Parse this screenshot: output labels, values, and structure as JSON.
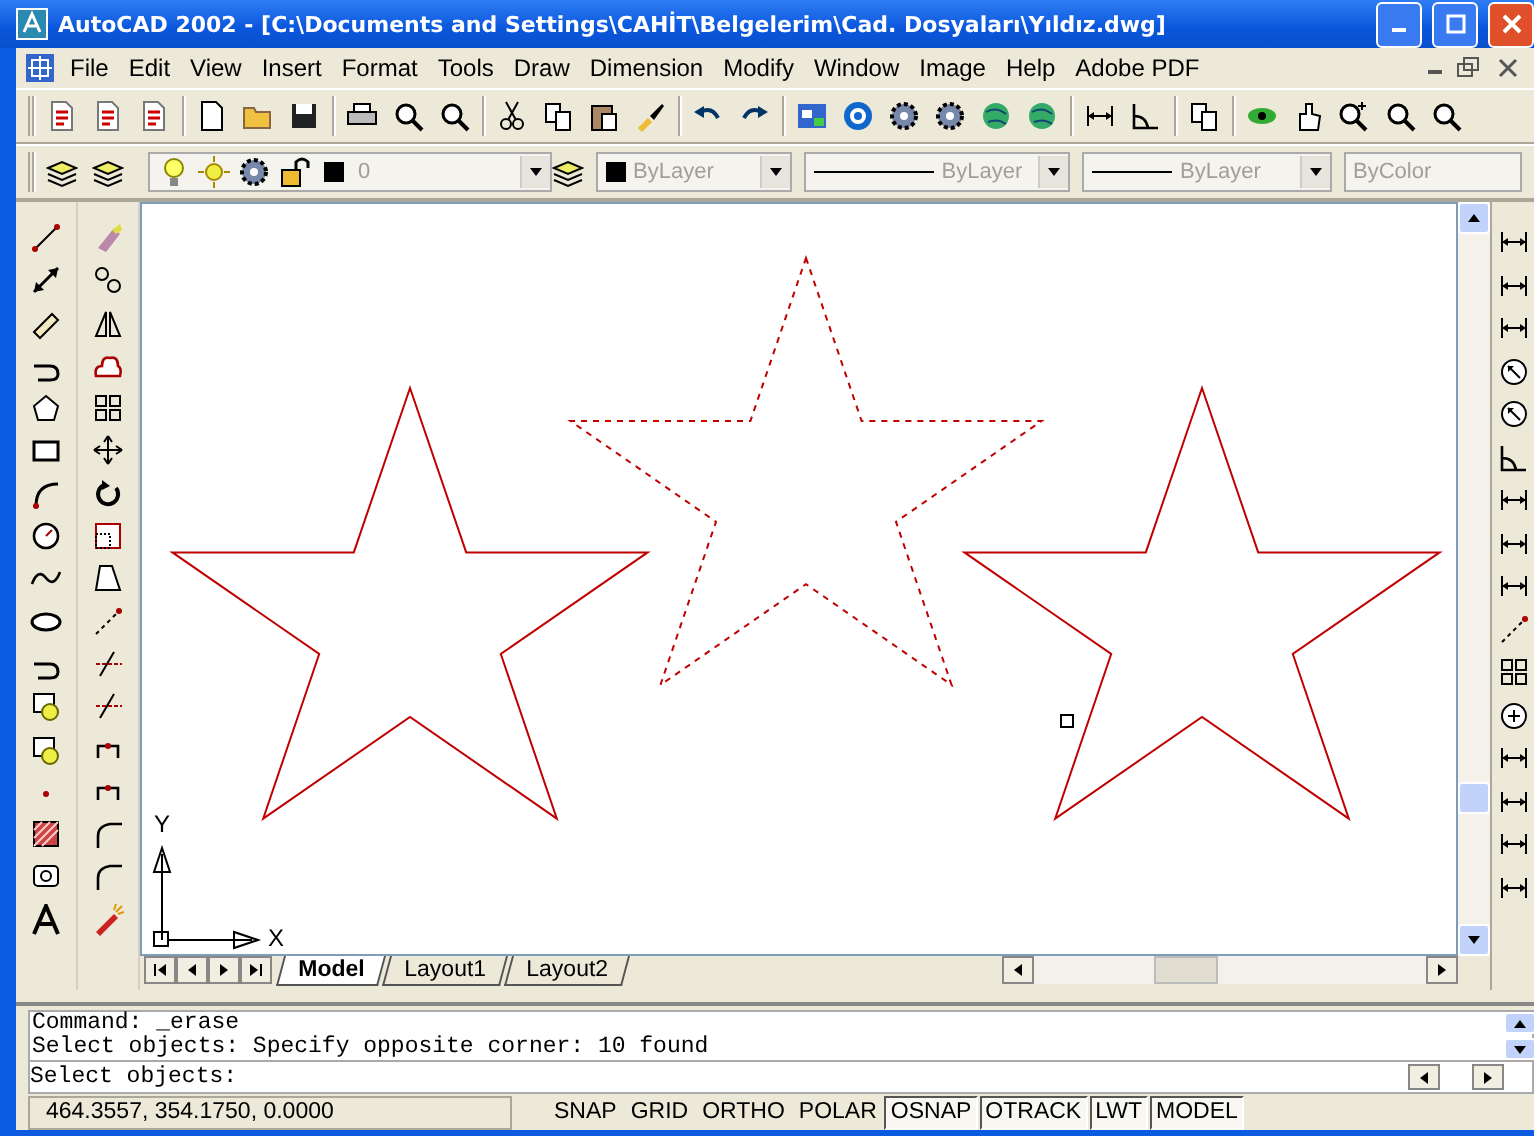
{
  "window": {
    "title": "AutoCAD 2002 - [C:\\Documents and Settings\\CAHİT\\Belgelerim\\Cad. Dosyaları\\Yıldız.dwg]"
  },
  "menu": [
    "File",
    "Edit",
    "View",
    "Insert",
    "Format",
    "Tools",
    "Draw",
    "Dimension",
    "Modify",
    "Window",
    "Image",
    "Help",
    "Adobe PDF"
  ],
  "properties_bar": {
    "layer": {
      "value": "0",
      "disabled": true
    },
    "combos": [
      {
        "value": "ByLayer",
        "kind": "color",
        "disabled": true
      },
      {
        "value": "ByLayer",
        "kind": "linetype",
        "disabled": true
      },
      {
        "value": "ByLayer",
        "kind": "lineweight",
        "disabled": true
      },
      {
        "value": "ByColor",
        "kind": "plotstyle",
        "disabled": true
      }
    ]
  },
  "drawing": {
    "stars": [
      {
        "selected": false
      },
      {
        "selected": true
      },
      {
        "selected": false
      }
    ],
    "ucs": {
      "x_label": "X",
      "y_label": "Y"
    }
  },
  "layout_tabs": [
    {
      "label": "Model",
      "selected": true
    },
    {
      "label": "Layout1",
      "selected": false
    },
    {
      "label": "Layout2",
      "selected": false
    }
  ],
  "command_history": [
    "Command: _erase",
    "Select objects: Specify opposite corner: 10 found"
  ],
  "command_prompt": "Select objects:",
  "status_bar": {
    "coordinates": "464.3557, 354.1750, 0.0000",
    "toggles": [
      {
        "label": "SNAP",
        "on": false
      },
      {
        "label": "GRID",
        "on": false
      },
      {
        "label": "ORTHO",
        "on": false
      },
      {
        "label": "POLAR",
        "on": false
      },
      {
        "label": "OSNAP",
        "on": true
      },
      {
        "label": "OTRACK",
        "on": true
      },
      {
        "label": "LWT",
        "on": true
      },
      {
        "label": "MODEL",
        "on": true
      }
    ]
  }
}
